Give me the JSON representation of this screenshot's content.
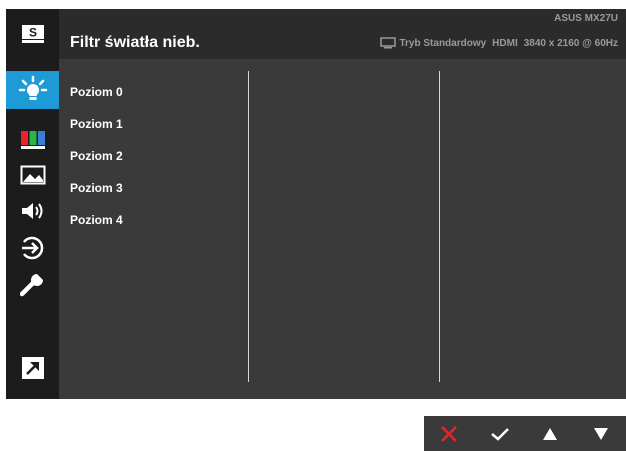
{
  "header": {
    "title": "Filtr światła nieb.",
    "model": "ASUS MX27U",
    "mode": "Tryb Standardowy",
    "input": "HDMI",
    "resolution": "3840 x 2160 @ 60Hz"
  },
  "sidebar": {
    "items": [
      {
        "name": "splendid-icon",
        "label": "S"
      },
      {
        "name": "blue-light-filter-icon",
        "active": true
      },
      {
        "name": "color-icon"
      },
      {
        "name": "image-icon"
      },
      {
        "name": "sound-icon"
      },
      {
        "name": "input-select-icon"
      },
      {
        "name": "system-setup-icon"
      },
      {
        "name": "shortcut-icon"
      }
    ]
  },
  "options": [
    "Poziom 0",
    "Poziom 1",
    "Poziom 2",
    "Poziom 3",
    "Poziom 4"
  ],
  "keys": [
    "close-icon",
    "check-icon",
    "up-arrow-icon",
    "down-arrow-icon"
  ],
  "colors": {
    "accent": "#1e9ad6",
    "close": "#e8232a",
    "panel": "#3a3a3a",
    "sidebar": "#1c1c1c"
  }
}
